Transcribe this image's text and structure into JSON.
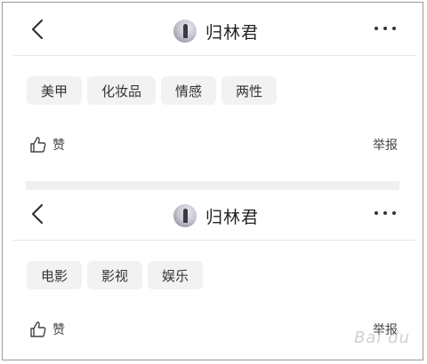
{
  "posts": [
    {
      "header": {
        "username": "归林君",
        "back_icon": "chevron-left-icon",
        "more_icon": "more-dots-icon"
      },
      "tags": [
        "美甲",
        "化妆品",
        "情感",
        "两性"
      ],
      "footer": {
        "like_label": "赞",
        "report_label": "举报",
        "like_icon": "thumbs-up-icon"
      }
    },
    {
      "header": {
        "username": "归林君",
        "back_icon": "chevron-left-icon",
        "more_icon": "more-dots-icon"
      },
      "tags": [
        "电影",
        "影视",
        "娱乐"
      ],
      "footer": {
        "like_label": "赞",
        "report_label": "举报",
        "like_icon": "thumbs-up-icon"
      }
    }
  ],
  "watermark": "Bai du"
}
